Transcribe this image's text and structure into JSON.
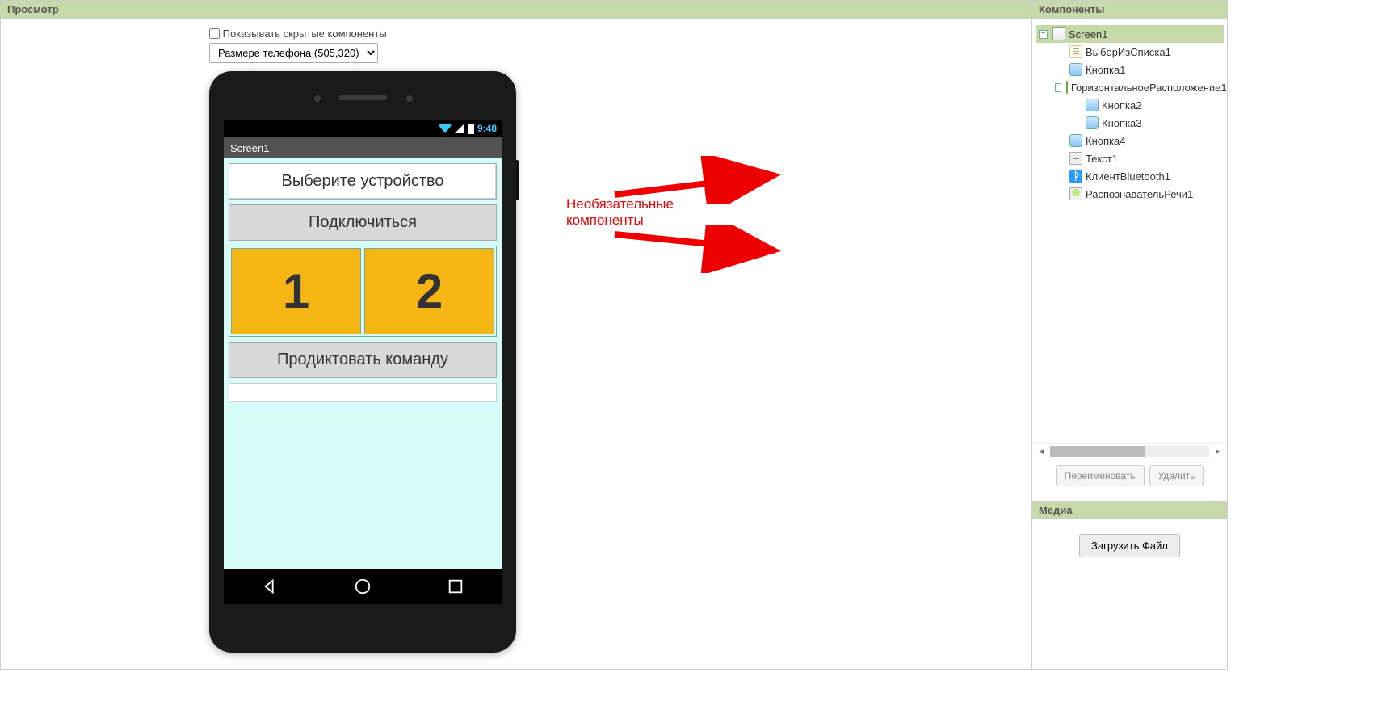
{
  "viewer": {
    "title": "Просмотр",
    "show_hidden_label": "Показывать скрытые компоненты",
    "size_select": "Размере телефона (505,320)"
  },
  "phone": {
    "status_time": "9:48",
    "screen_title": "Screen1",
    "listpicker_text": "Выберите устройство",
    "connect_btn": "Подключиться",
    "num_btn_1": "1",
    "num_btn_2": "2",
    "dictate_btn": "Продиктовать команду"
  },
  "annotation": {
    "optional_label_line1": "Необязательные",
    "optional_label_line2": "компоненты"
  },
  "components": {
    "title": "Компоненты",
    "tree": {
      "screen1": "Screen1",
      "listpicker1": "ВыборИзСписка1",
      "button1": "Кнопка1",
      "hlayout1": "ГоризонтальноеРасположение1",
      "button2": "Кнопка2",
      "button3": "Кнопка3",
      "button4": "Кнопка4",
      "text1": "Текст1",
      "btclient1": "КлиентBluetooth1",
      "speech1": "РаспознавательРечи1"
    },
    "rename_btn": "Переименовать",
    "delete_btn": "Удалить"
  },
  "media": {
    "title": "Медиа",
    "upload_btn": "Загрузить Файл"
  }
}
